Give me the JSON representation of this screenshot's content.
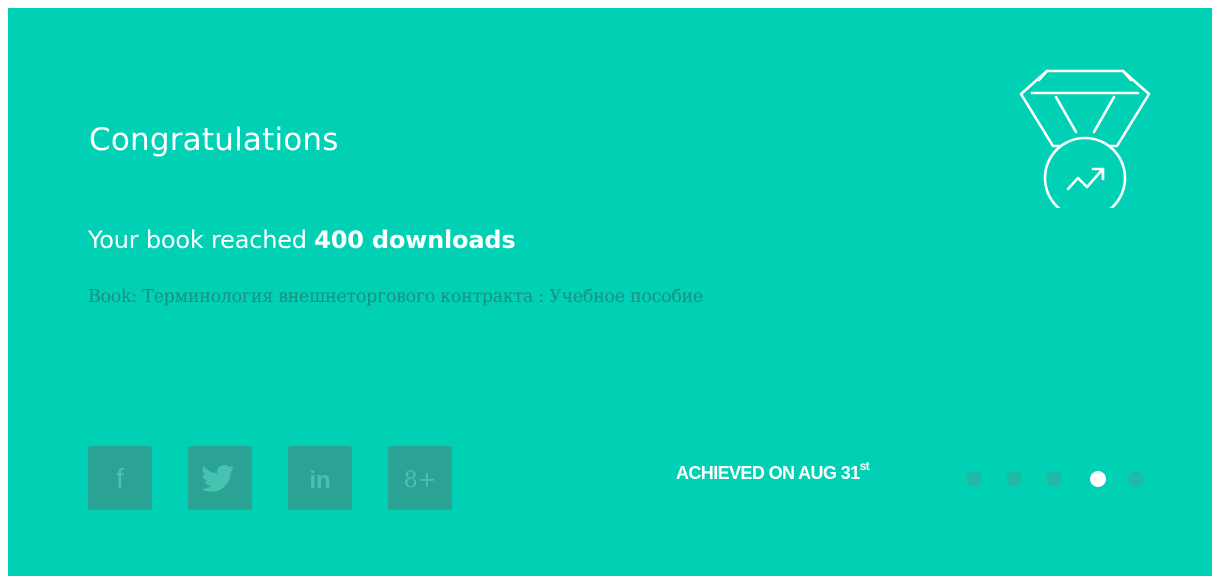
{
  "notification": {
    "title": "Congratulations",
    "headline_prefix": "Your book reached",
    "headline_bold": "400 downloads",
    "book_line": "Book: Терминология внешнеторгового контракта : Учебное пособие",
    "achieved_text": "ACHIEVED ON AUG 31",
    "achieved_suffix": "st",
    "medal_icon": "medal-trend-icon"
  },
  "social": [
    {
      "icon": "facebook-icon",
      "label": "f"
    },
    {
      "icon": "twitter-icon"
    },
    {
      "icon": "linkedin-icon",
      "label": "in"
    },
    {
      "icon": "google-plus-icon",
      "label": "8+"
    }
  ],
  "pager": {
    "total": 5,
    "active_index": 3
  },
  "colors": {
    "card_bg": "#00d1b5",
    "social_bg": "#2aa294",
    "dot_inactive": "#1ebaa5",
    "dot_active": "#ffffff",
    "book_text": "#1e8e80"
  }
}
